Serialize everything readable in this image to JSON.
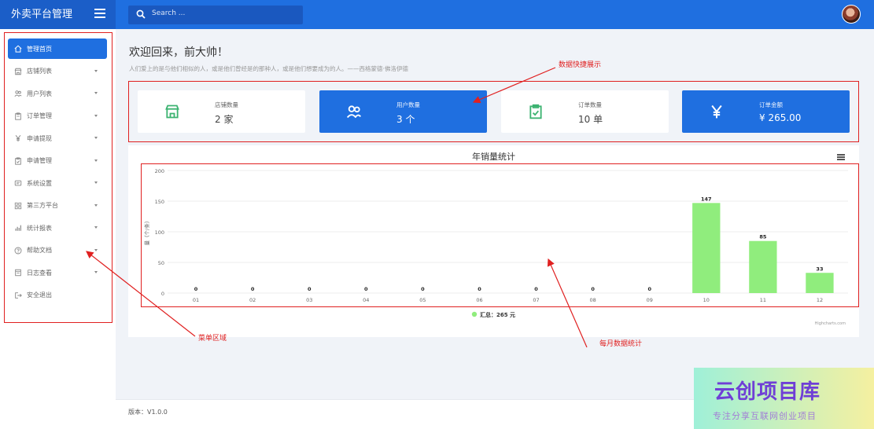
{
  "app": {
    "title": "外卖平台管理"
  },
  "search": {
    "placeholder": "Search ..."
  },
  "sidebar": {
    "items": [
      {
        "label": "管理首页",
        "icon": "home-icon",
        "active": true,
        "has_arrow": false
      },
      {
        "label": "店铺列表",
        "icon": "store-icon",
        "has_arrow": true
      },
      {
        "label": "用户列表",
        "icon": "users-icon",
        "has_arrow": true
      },
      {
        "label": "订单管理",
        "icon": "clipboard-icon",
        "has_arrow": true
      },
      {
        "label": "申请提现",
        "icon": "yen-icon",
        "has_arrow": true
      },
      {
        "label": "申请管理",
        "icon": "clipboard-check-icon",
        "has_arrow": true
      },
      {
        "label": "系统设置",
        "icon": "settings-icon",
        "has_arrow": true
      },
      {
        "label": "第三方平台",
        "icon": "grid-icon",
        "has_arrow": true
      },
      {
        "label": "统计报表",
        "icon": "bar-chart-icon",
        "has_arrow": true
      },
      {
        "label": "帮助文档",
        "icon": "help-icon",
        "has_arrow": true
      },
      {
        "label": "日志查看",
        "icon": "log-icon",
        "has_arrow": true
      },
      {
        "label": "安全退出",
        "icon": "logout-icon",
        "has_arrow": false
      }
    ]
  },
  "main": {
    "welcome": "欢迎回来，前大帅！",
    "quote": "人们爱上的是与他们相似的人，或是他们曾经是的那种人，或是他们想要成为的人。——西格蒙德·佛洛伊德",
    "cards": [
      {
        "label": "店铺数量",
        "value": "2 家",
        "icon": "store-icon",
        "style": "white"
      },
      {
        "label": "用户数量",
        "value": "3 个",
        "icon": "users-icon",
        "style": "blue"
      },
      {
        "label": "订单数量",
        "value": "10 单",
        "icon": "clipboard-check-icon",
        "style": "white"
      },
      {
        "label": "订单金额",
        "value": "¥ 265.00",
        "icon": "yen-icon",
        "style": "blue"
      }
    ]
  },
  "chart_data": {
    "type": "bar",
    "title": "年销量统计",
    "ylabel": "量（个/条）",
    "categories": [
      "01",
      "02",
      "03",
      "04",
      "05",
      "06",
      "07",
      "08",
      "09",
      "10",
      "11",
      "12"
    ],
    "series": [
      {
        "name": "汇总：265 元",
        "values": [
          0,
          0,
          0,
          0,
          0,
          0,
          0,
          0,
          0,
          147,
          85,
          33
        ]
      }
    ],
    "ylim": [
      0,
      200
    ],
    "yticks": [
      0,
      50,
      100,
      150,
      200
    ],
    "bar_color": "#90ed7d",
    "credit": "Highcharts.com",
    "grid": true,
    "legend_position": "bottom-center"
  },
  "footer": {
    "version": "版本：V1.0.0"
  },
  "annotations": {
    "data_display": "数据快捷展示",
    "menu_area": "菜单区域",
    "monthly_stats": "每月数据统计"
  },
  "watermark": {
    "title": "云创项目库",
    "subtitle": "专注分享互联网创业项目"
  },
  "colors": {
    "primary": "#1f6fe0",
    "annotation": "#e02020",
    "icon_green": "#3cb371"
  }
}
